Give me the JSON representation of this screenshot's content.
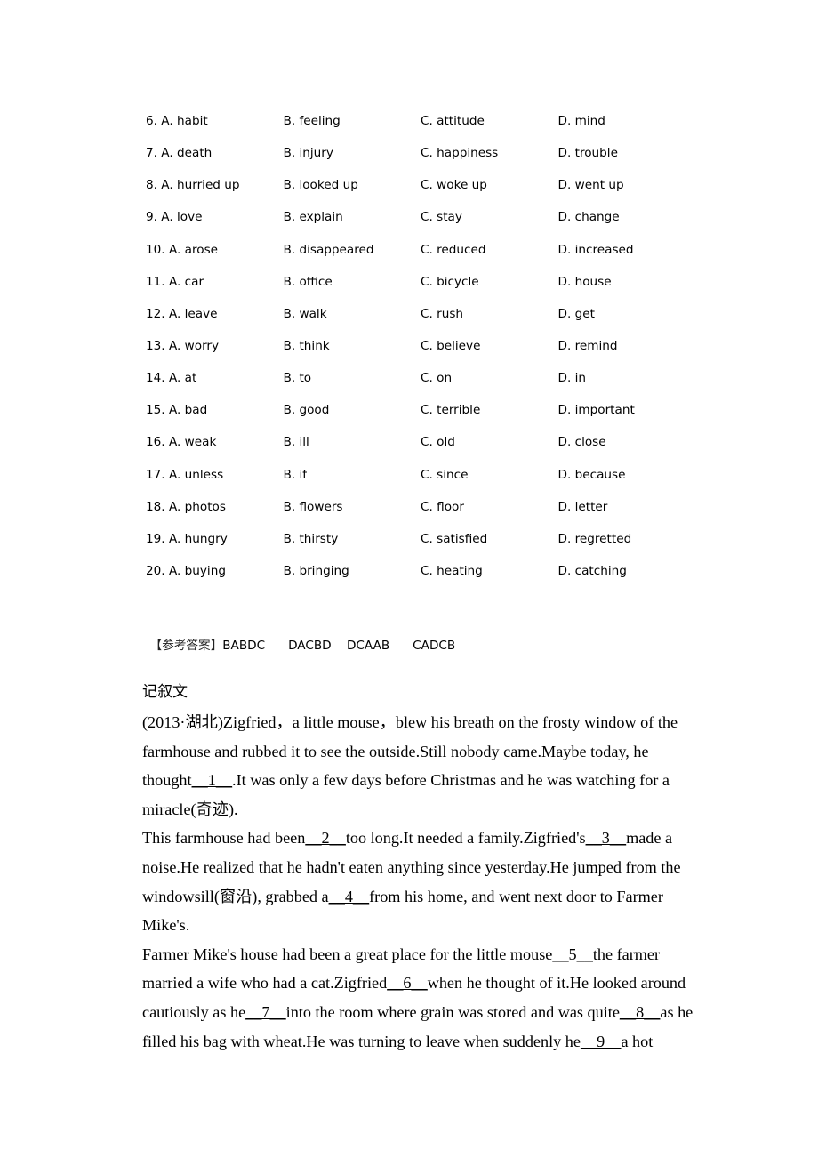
{
  "options": [
    [
      "6. A. habit",
      "B. feeling",
      "C. attitude",
      "D. mind"
    ],
    [
      "7. A. death",
      "B. injury",
      "C. happiness",
      "D. trouble"
    ],
    [
      "8. A. hurried up",
      "B. looked up",
      "C. woke up",
      "D. went up"
    ],
    [
      "9. A. love",
      "B. explain",
      "C. stay",
      "D. change"
    ],
    [
      "10. A. arose",
      "B. disappeared",
      "C. reduced",
      "D. increased"
    ],
    [
      "11. A. car",
      "B. office",
      "C. bicycle",
      "D. house"
    ],
    [
      "12. A. leave",
      "B. walk",
      "C. rush",
      "D. get"
    ],
    [
      "13. A. worry",
      "B. think",
      "C. believe",
      "D. remind"
    ],
    [
      "14. A. at",
      "B. to",
      "C. on",
      "D. in"
    ],
    [
      "15. A. bad",
      "B. good",
      "C. terrible",
      "D. important"
    ],
    [
      "16. A. weak",
      "B. ill",
      "C. old",
      "D. close"
    ],
    [
      "17. A. unless",
      "B. if",
      "C. since",
      "D. because"
    ],
    [
      "18. A. photos",
      "B. flowers",
      "C. floor",
      "D. letter"
    ],
    [
      "19. A. hungry",
      "B. thirsty",
      "C. satisfied",
      "D. regretted"
    ],
    [
      "20. A. buying",
      "B. bringing",
      "C. heating",
      "D. catching"
    ]
  ],
  "answer": {
    "label": "【参考答案】",
    "groups": [
      "BABDC",
      "DACBD",
      "DCAAB",
      "CADCB"
    ]
  },
  "section_heading": "记叙文",
  "passage": {
    "paragraphs": [
      [
        {
          "t": "(2013·湖北)Zigfried，a little mouse，blew his breath on the frosty window of the farmhouse and rubbed it to see the outside.Still nobody came.Maybe today, he thought"
        },
        {
          "b": "__1__"
        },
        {
          "t": ".It was only a few days before Christmas and he was watching for a miracle(奇迹)."
        }
      ],
      [
        {
          "t": "This farmhouse had been"
        },
        {
          "b": "__2__"
        },
        {
          "t": "too long.It needed a family.Zigfried's"
        },
        {
          "b": "__3__"
        },
        {
          "t": "made a noise.He realized that he hadn't eaten anything since yesterday.He jumped from the windowsill(窗沿), grabbed a"
        },
        {
          "b": "__4__"
        },
        {
          "t": "from his home, and went next door to Farmer Mike's."
        }
      ],
      [
        {
          "t": "Farmer Mike's house had been a great place for the little mouse"
        },
        {
          "b": "__5__"
        },
        {
          "t": "the farmer married a wife who had a cat.Zigfried"
        },
        {
          "b": "__6__"
        },
        {
          "t": "when he thought of it.He looked around cautiously as he"
        },
        {
          "b": "__7__"
        },
        {
          "t": "into the room where grain was stored and was quite"
        },
        {
          "b": "__8__"
        },
        {
          "t": "as he filled his bag with wheat.He was turning to leave when suddenly he"
        },
        {
          "b": "__9__"
        },
        {
          "t": "a hot"
        }
      ]
    ]
  }
}
